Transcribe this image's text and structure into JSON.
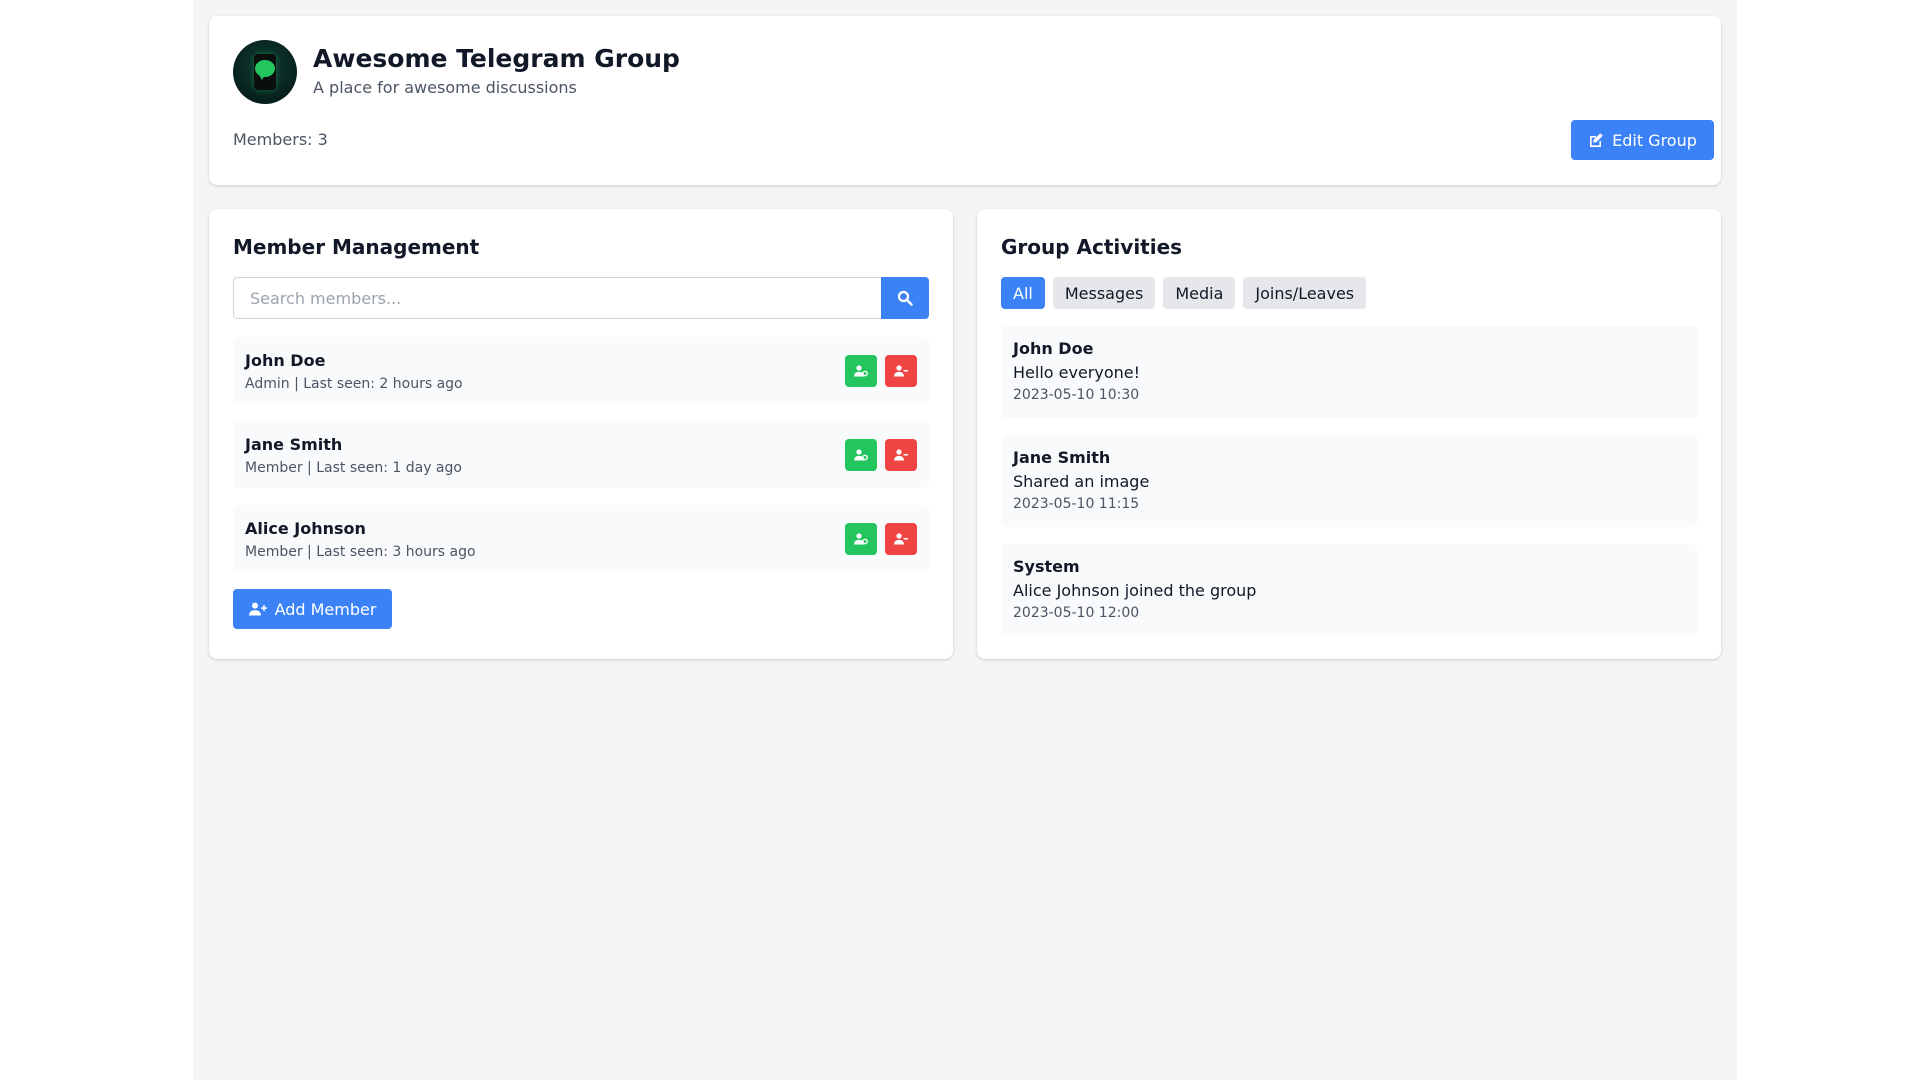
{
  "header": {
    "group_name": "Awesome Telegram Group",
    "group_description": "A place for awesome discussions",
    "members_label": "Members: 3",
    "edit_label": "Edit Group"
  },
  "members": {
    "title": "Member Management",
    "search_placeholder": "Search members...",
    "search_value": "",
    "list": [
      {
        "name": "John Doe",
        "meta": "Admin | Last seen: 2 hours ago"
      },
      {
        "name": "Jane Smith",
        "meta": "Member | Last seen: 1 day ago"
      },
      {
        "name": "Alice Johnson",
        "meta": "Member | Last seen: 3 hours ago"
      }
    ],
    "add_label": "Add Member"
  },
  "activities": {
    "title": "Group Activities",
    "tabs": [
      "All",
      "Messages",
      "Media",
      "Joins/Leaves"
    ],
    "active_tab": "All",
    "items": [
      {
        "user": "John Doe",
        "text": "Hello everyone!",
        "time": "2023-05-10 10:30"
      },
      {
        "user": "Jane Smith",
        "text": "Shared an image",
        "time": "2023-05-10 11:15"
      },
      {
        "user": "System",
        "text": "Alice Johnson joined the group",
        "time": "2023-05-10 12:00"
      }
    ]
  },
  "icons": {
    "edit": "edit-icon",
    "search": "search-icon",
    "promote": "user-cog-icon",
    "remove": "user-minus-icon",
    "add": "user-plus-icon"
  },
  "colors": {
    "primary": "#3b82f6",
    "success": "#22c55e",
    "danger": "#ef4444",
    "background": "#f3f4f6"
  }
}
